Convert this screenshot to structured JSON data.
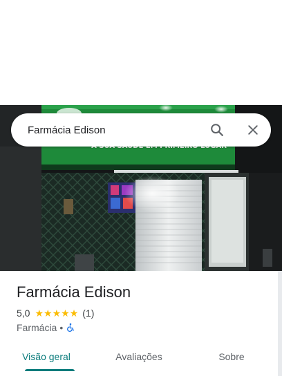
{
  "search": {
    "value": "Farmácia Edison"
  },
  "photo": {
    "sign_text": "A SUA SAÚDE EM PRIMEIRO LUGAR"
  },
  "place": {
    "name": "Farmácia Edison",
    "rating": "5,0",
    "stars": [
      "★",
      "★",
      "★",
      "★",
      "★"
    ],
    "review_count": "(1)",
    "category": "Farmácia",
    "separator": "•"
  },
  "tabs": [
    {
      "label": "Visão geral",
      "active": true
    },
    {
      "label": "Avaliações",
      "active": false
    },
    {
      "label": "Sobre",
      "active": false
    }
  ],
  "colors": {
    "accent": "#0b7c7c",
    "star": "#fbbc04",
    "accessibility_icon": "#1a73e8",
    "sign_green": "#1e8a3a"
  },
  "icons": {
    "search": "search-icon",
    "close": "close-icon",
    "accessibility": "wheelchair-icon"
  }
}
